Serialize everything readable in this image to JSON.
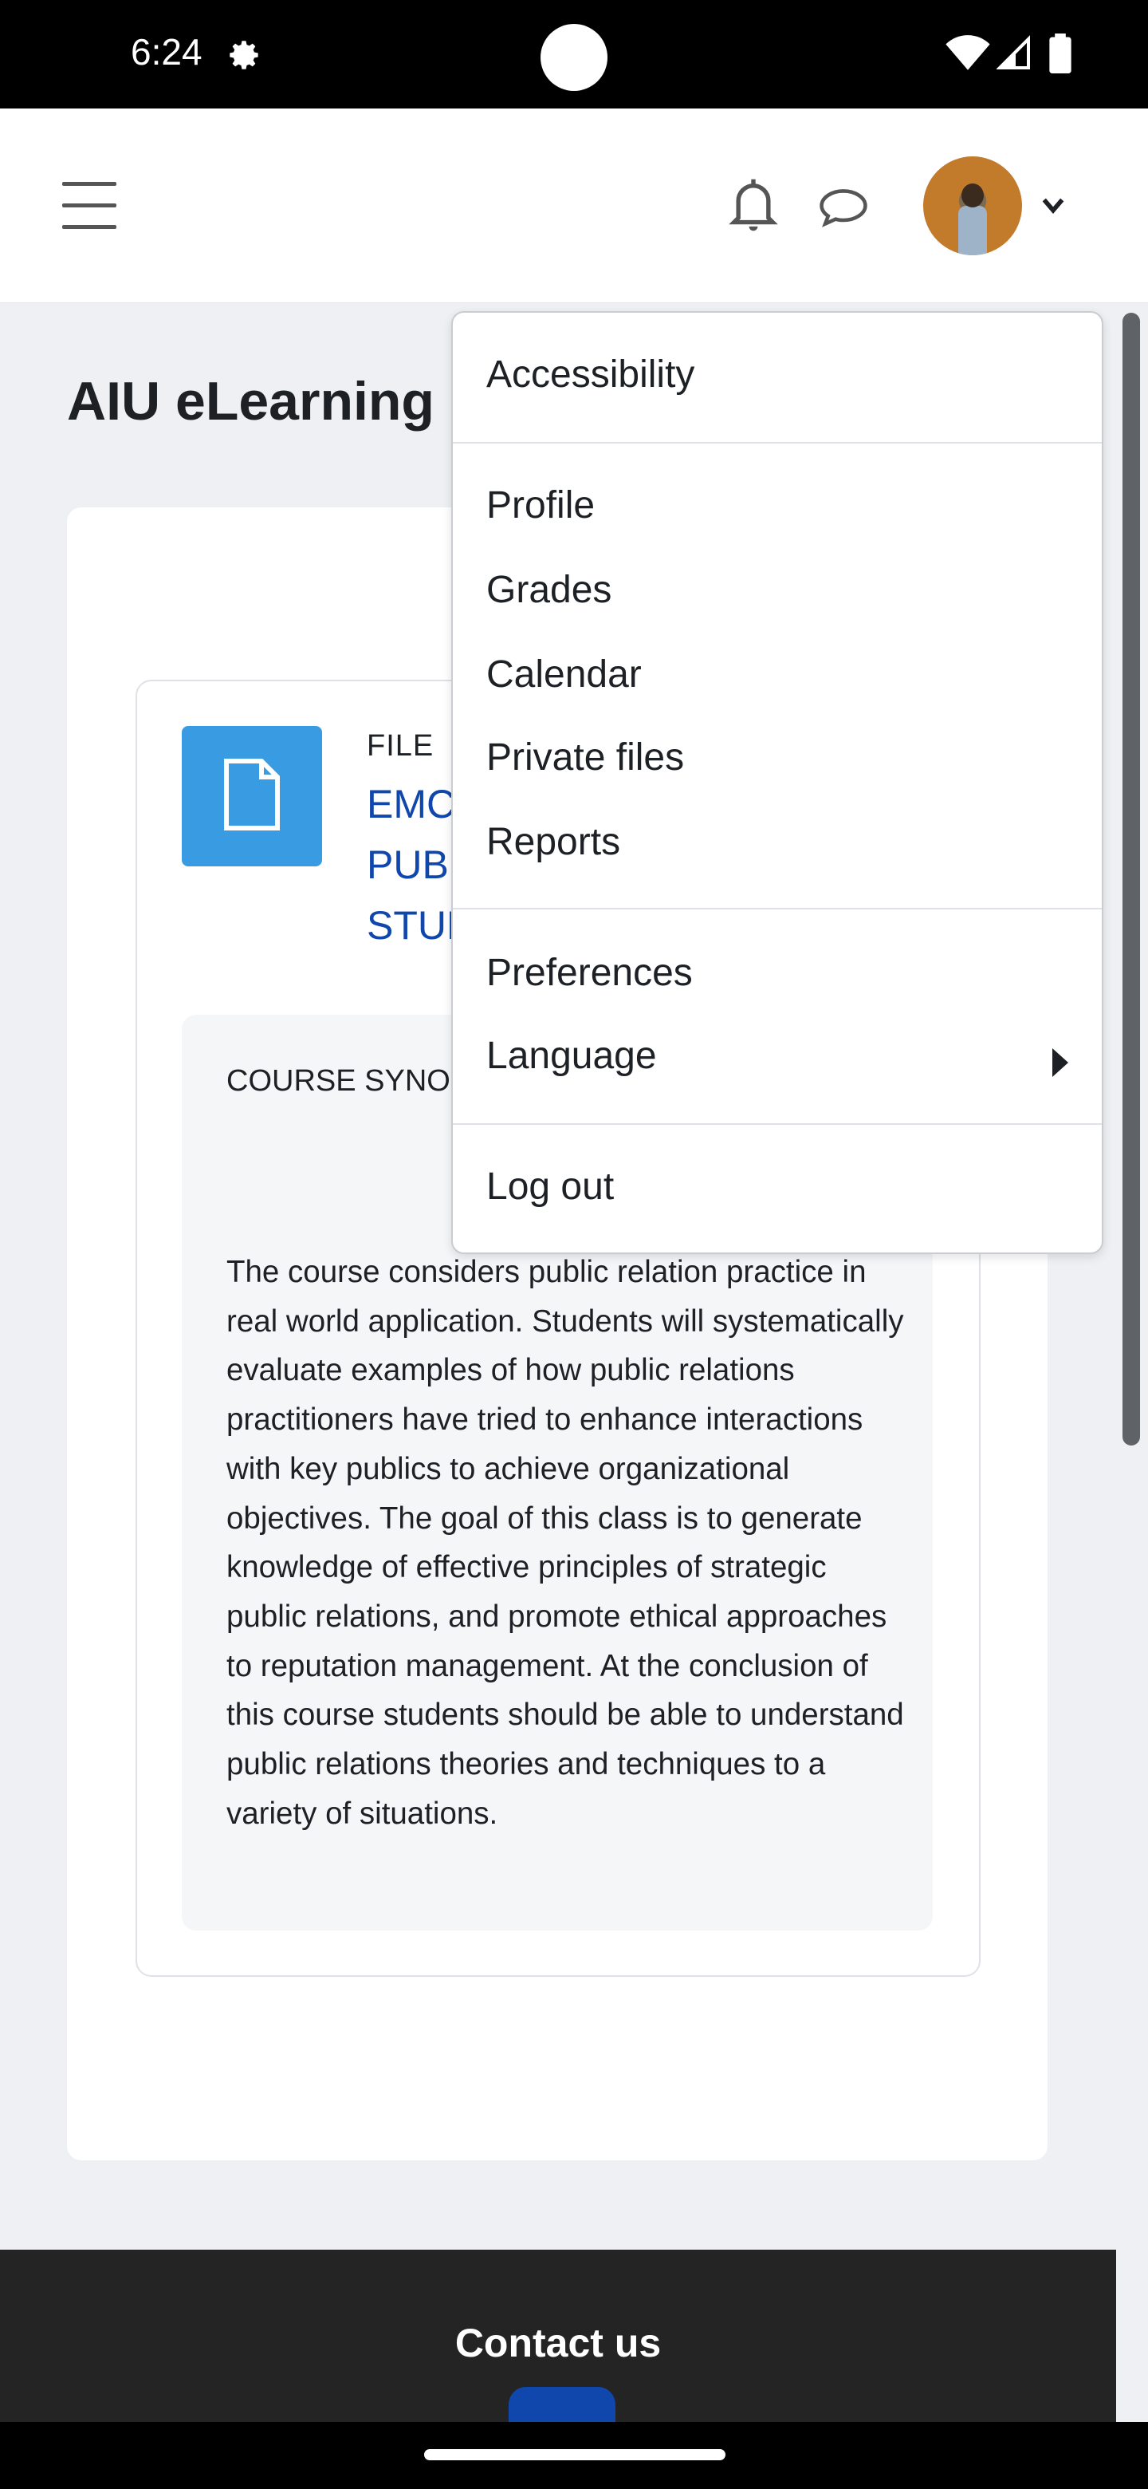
{
  "status_bar": {
    "time": "6:24",
    "icons": [
      "settings-gear-icon",
      "wifi-icon",
      "cell-signal-icon",
      "battery-icon"
    ]
  },
  "header": {
    "icons": [
      "hamburger-menu-icon",
      "notification-bell-icon",
      "messages-chat-icon",
      "user-avatar",
      "chevron-down-icon"
    ]
  },
  "page": {
    "title": "AIU eLearning"
  },
  "activity": {
    "type_label": "FILE",
    "link_lines": [
      "EMC",
      "PUBL",
      "STUD"
    ],
    "icon": "file-document-icon",
    "icon_color": "#399be2"
  },
  "synopsis": {
    "heading": "COURSE SYNOP",
    "text": "The course considers public relation practice in real world application. Students will systematically evaluate examples of how public relations practitioners have tried to enhance interactions with key publics to achieve organizational objectives. The goal of this class is to generate knowledge of effective principles of strategic public relations, and promote ethical approaches to reputation management. At the conclusion of this course students should be able to understand public relations theories and techniques to a variety of situations."
  },
  "user_menu": {
    "items": [
      {
        "label": "Accessibility"
      },
      {
        "label": "Profile"
      },
      {
        "label": "Grades"
      },
      {
        "label": "Calendar"
      },
      {
        "label": "Private files"
      },
      {
        "label": "Reports"
      },
      {
        "label": "Preferences"
      },
      {
        "label": "Language",
        "submenu_icon": "caret-right-icon"
      },
      {
        "label": "Log out"
      }
    ]
  },
  "footer": {
    "contact_label": "Contact us"
  },
  "colors": {
    "link": "#0f47ad",
    "file_icon_bg": "#399be2",
    "footer_bg": "#242424",
    "page_bg": "#eef0f3"
  }
}
